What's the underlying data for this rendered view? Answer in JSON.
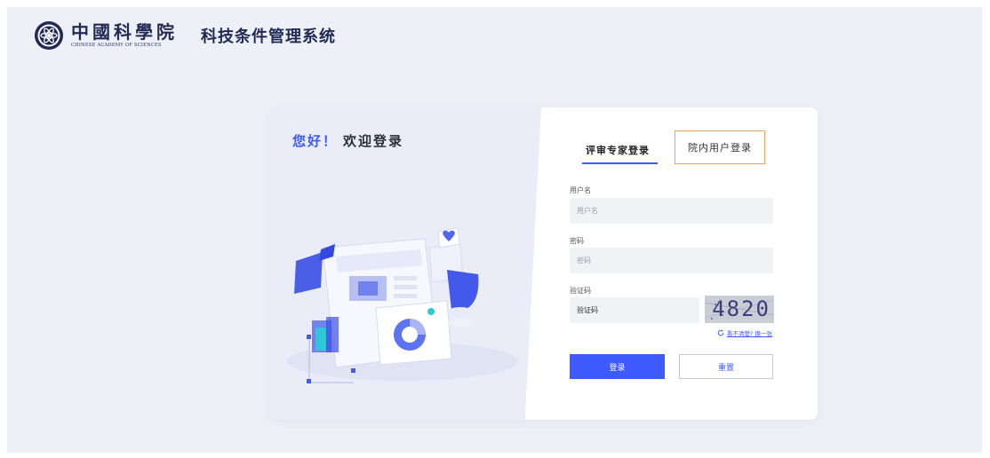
{
  "header": {
    "logo_cn": "中國科學院",
    "logo_en": "CHINESE ACADEMY OF SCIENCES",
    "system_title": "科技条件管理系统"
  },
  "login_card": {
    "greeting_hi": "您好！",
    "greeting_welcome": "欢迎登录",
    "tabs": {
      "expert": "评审专家登录",
      "internal": "院内用户登录",
      "active": "expert"
    },
    "username": {
      "label": "用户名",
      "placeholder": "用户名"
    },
    "password": {
      "label": "密码",
      "placeholder": "密码"
    },
    "captcha": {
      "label": "验证码",
      "placeholder": "验证码",
      "image_text": "4820",
      "refresh_text": "看不清楚? 换一张"
    },
    "buttons": {
      "login": "登录",
      "reset": "重置"
    }
  },
  "colors": {
    "accent": "#3d5aff",
    "tab_highlight_border": "#f0a060",
    "background": "#eef0f7"
  },
  "icons": [
    "cas-emblem-icon",
    "refresh-icon"
  ]
}
